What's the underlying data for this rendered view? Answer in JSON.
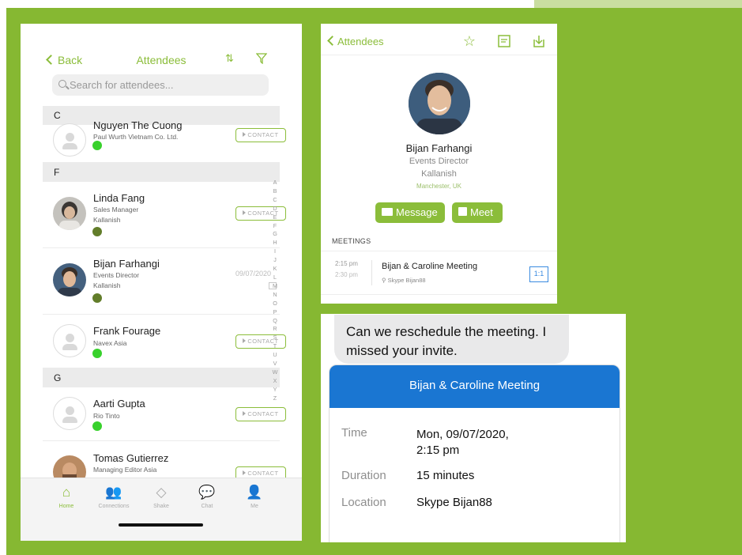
{
  "colors": {
    "background": "#86b832",
    "accent": "#8bbd3a",
    "meeting_blue": "#1a76d2",
    "online": "#38d12c",
    "offline": "#627d2a"
  },
  "left": {
    "back_label": "Back",
    "title": "Attendees",
    "search_placeholder": "Search for attendees...",
    "sections": [
      {
        "letter": "C"
      },
      {
        "letter": "F"
      },
      {
        "letter": "G"
      }
    ],
    "attendees": [
      {
        "name": "Nguyen The Cuong",
        "title": "",
        "company": "Paul Wurth Vietnam Co. Ltd.",
        "status": "online",
        "action": "CONTACT"
      },
      {
        "name": "Linda Fang",
        "title": "Sales Manager",
        "company": "Kallanish",
        "status": "offline",
        "action": "CONTACT"
      },
      {
        "name": "Bijan Farhangi",
        "title": "Events Director",
        "company": "Kallanish",
        "status": "offline",
        "date": "09/07/2020"
      },
      {
        "name": "Frank Fourage",
        "title": "Navex Asia",
        "company": "",
        "status": "online",
        "action": "CONTACT"
      },
      {
        "name": "Aarti Gupta",
        "title": "Rio Tinto",
        "company": "",
        "status": "online",
        "action": "CONTACT"
      },
      {
        "name": "Tomas Gutierrez",
        "title": "Managing Editor Asia",
        "company": "",
        "status": "",
        "action": "CONTACT"
      }
    ],
    "alphabet": "A B C D E F G H I J K L M N O P Q R S T U V W X Y Z",
    "tabs": [
      {
        "label": "Home",
        "icon": "home-icon"
      },
      {
        "label": "Connections",
        "icon": "connections-icon"
      },
      {
        "label": "Shake",
        "icon": "shake-icon"
      },
      {
        "label": "Chat",
        "icon": "chat-icon"
      },
      {
        "label": "Me",
        "icon": "me-icon"
      }
    ]
  },
  "profile": {
    "back_label": "Attendees",
    "name": "Bijan Farhangi",
    "title": "Events Director",
    "company": "Kallanish",
    "location": "Manchester, UK",
    "message_label": "Message",
    "meet_label": "Meet",
    "meetings_header": "MEETINGS",
    "meeting": {
      "start": "2:15 pm",
      "end": "2:30 pm",
      "title": "Bijan & Caroline Meeting",
      "location": "Skype Bijan88",
      "badge": "1:1"
    }
  },
  "chat": {
    "message": "Can we reschedule the meeting. I missed your invite.",
    "card_title": "Bijan & Caroline Meeting",
    "time_label": "Time",
    "time_value_line1": "Mon, 09/07/2020,",
    "time_value_line2": "2:15 pm",
    "duration_label": "Duration",
    "duration_value": "15 minutes",
    "location_label": "Location",
    "location_value": "Skype Bijan88"
  }
}
